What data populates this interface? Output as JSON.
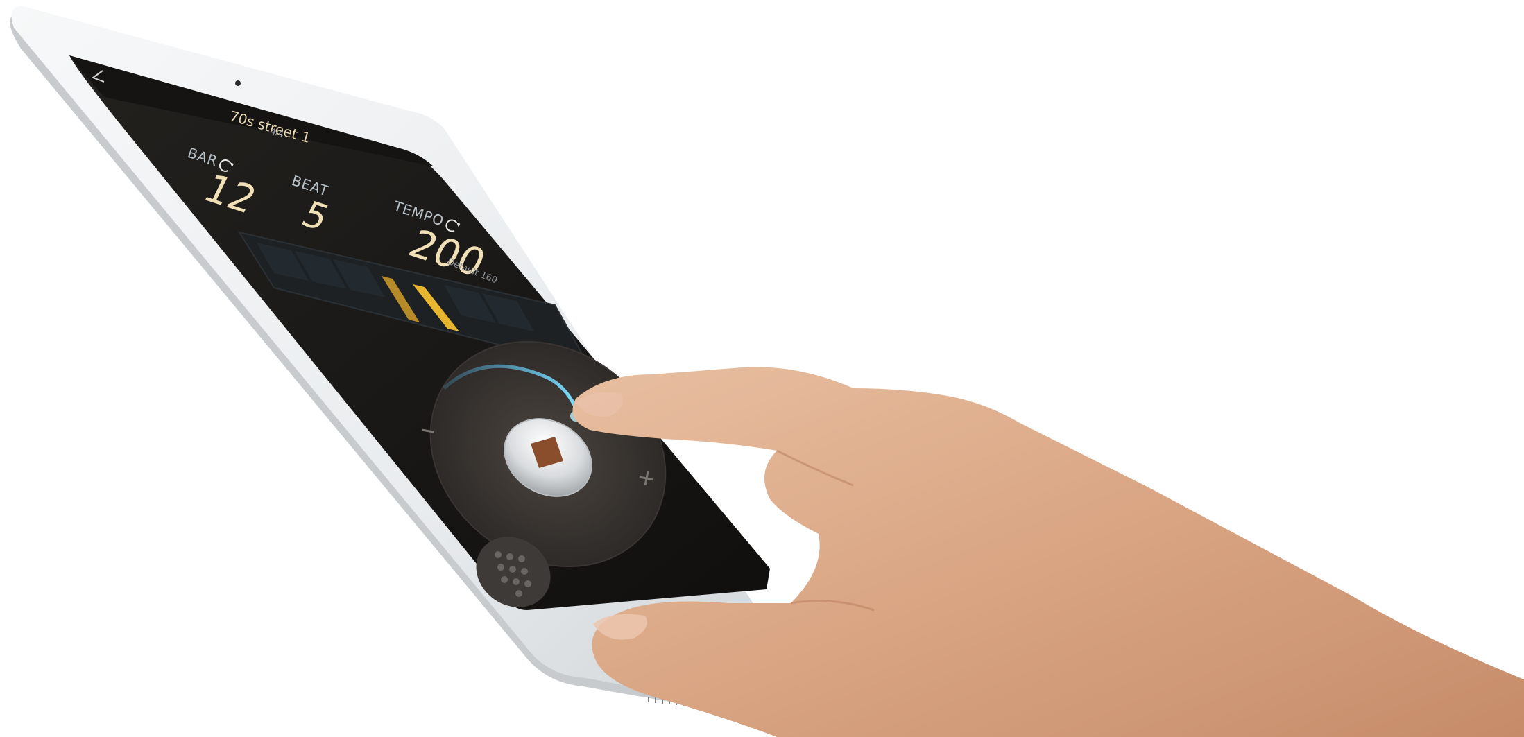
{
  "header": {
    "back_icon": "chevron-left-icon",
    "song_title": "70s street 1",
    "time_signature": "4/4"
  },
  "counters": {
    "bar_label": "BAR",
    "bar_value": "12",
    "beat_label": "BEAT",
    "beat_value": "5",
    "tempo_label": "TEMPO",
    "tempo_value": "200",
    "tempo_default": "Default 160"
  },
  "dial": {
    "minus_label": "–",
    "plus_label": "+",
    "stop_icon": "stop-square-icon",
    "accent_color": "#4fc3ff"
  },
  "keypad": {
    "icon": "keypad-dots-icon"
  },
  "colors": {
    "screen_bg": "#1a1816",
    "number_color": "#f1dfb6",
    "beat_bar_accent": "#e8b52e"
  }
}
